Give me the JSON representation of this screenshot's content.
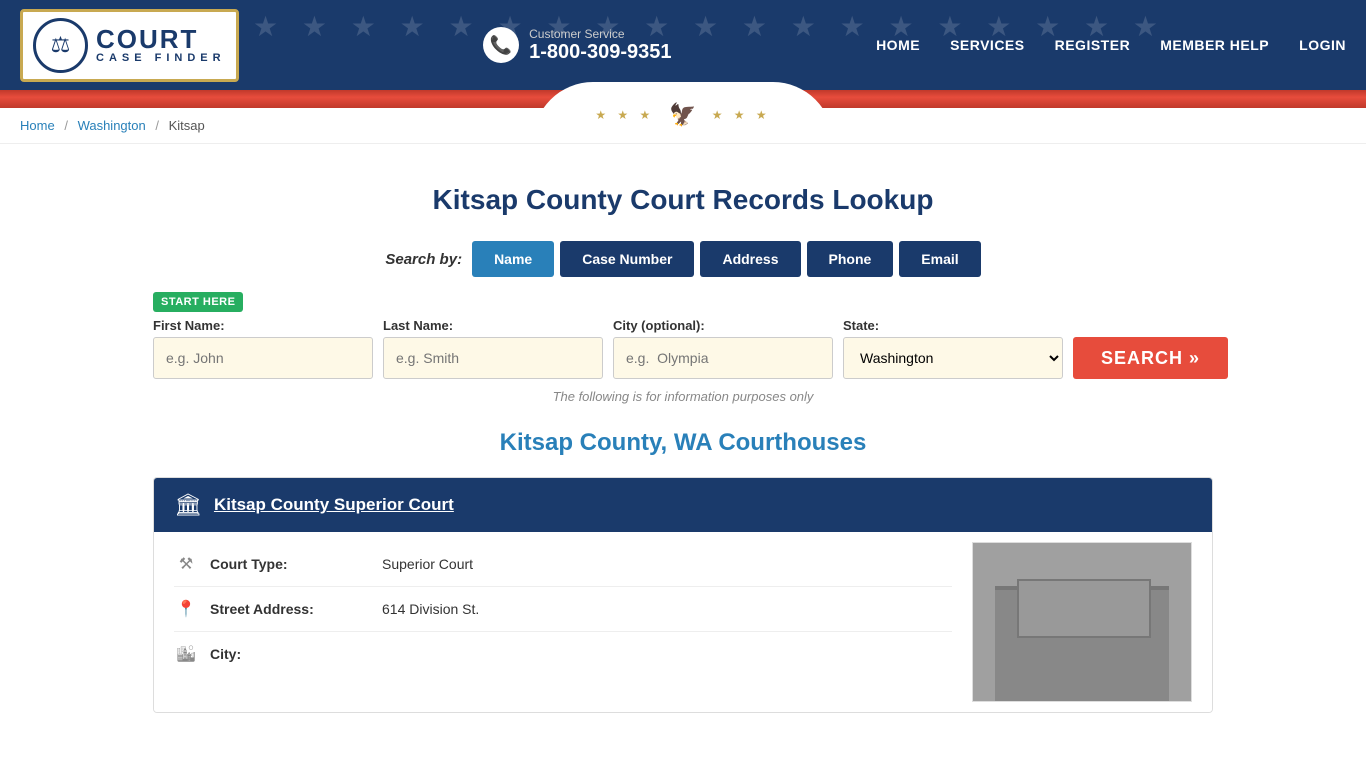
{
  "header": {
    "logo": {
      "court_text": "COURT",
      "case_finder_text": "CASE FINDER",
      "emblem_icon": "⚖"
    },
    "customer_service": {
      "label": "Customer Service",
      "phone": "1-800-309-9351",
      "icon": "📞"
    },
    "nav": {
      "home": "HOME",
      "services": "SERVICES",
      "register": "REGISTER",
      "member_help": "MEMBER HELP",
      "login": "LOGIN"
    }
  },
  "breadcrumb": {
    "home": "Home",
    "state": "Washington",
    "county": "Kitsap"
  },
  "page": {
    "title": "Kitsap County Court Records Lookup"
  },
  "search": {
    "by_label": "Search by:",
    "tabs": [
      {
        "label": "Name",
        "active": true
      },
      {
        "label": "Case Number",
        "active": false
      },
      {
        "label": "Address",
        "active": false
      },
      {
        "label": "Phone",
        "active": false
      },
      {
        "label": "Email",
        "active": false
      }
    ],
    "start_here": "START HERE",
    "fields": {
      "first_name_label": "First Name:",
      "first_name_placeholder": "e.g. John",
      "last_name_label": "Last Name:",
      "last_name_placeholder": "e.g. Smith",
      "city_label": "City (optional):",
      "city_placeholder": "e.g.  Olympia",
      "state_label": "State:",
      "state_value": "Washington"
    },
    "search_button": "SEARCH »",
    "info_note": "The following is for information purposes only"
  },
  "courthouses": {
    "section_title": "Kitsap County, WA Courthouses",
    "courts": [
      {
        "name": "Kitsap County Superior Court",
        "court_type_label": "Court Type:",
        "court_type_value": "Superior Court",
        "address_label": "Street Address:",
        "address_value": "614 Division St.",
        "city_label": "City:"
      }
    ]
  },
  "icons": {
    "building": "🏛",
    "gavel": "⚒",
    "location_pin": "📍",
    "city": "🏙"
  }
}
